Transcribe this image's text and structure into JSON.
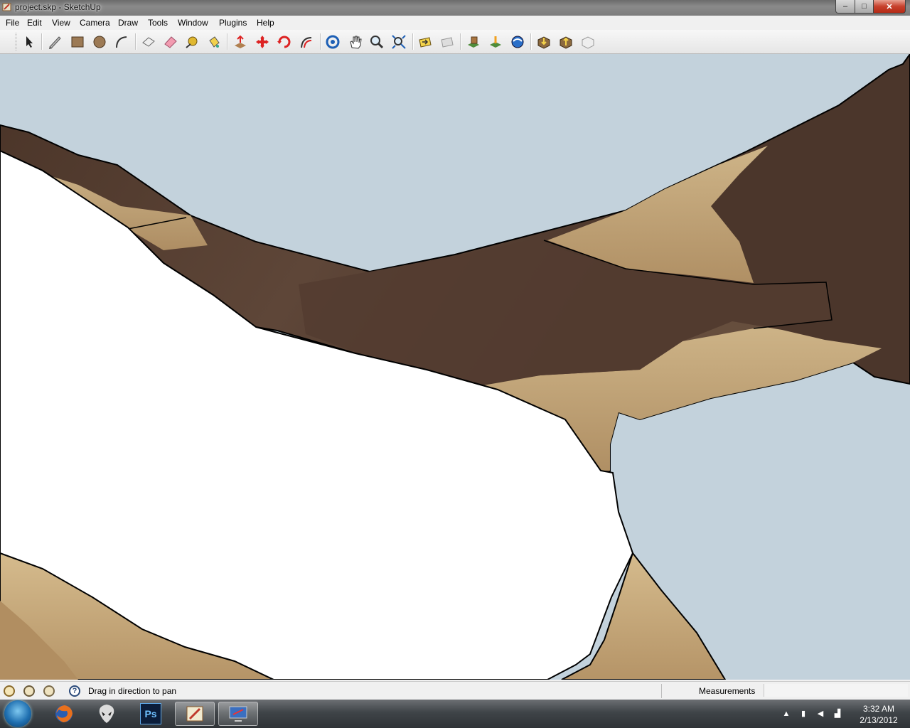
{
  "window": {
    "title": "project.skp - SketchUp",
    "controls": {
      "minimize": "–",
      "maximize": "□",
      "close": "✕"
    }
  },
  "menu": [
    "File",
    "Edit",
    "View",
    "Camera",
    "Draw",
    "Tools",
    "Window",
    "Plugins",
    "Help"
  ],
  "toolbar": {
    "tools": [
      "select-tool",
      "line-tool",
      "rectangle-tool",
      "circle-tool",
      "arc-tool",
      "make-component-tool",
      "eraser-tool",
      "tape-measure-tool",
      "paint-bucket-tool",
      "push-pull-tool",
      "move-tool",
      "rotate-tool",
      "offset-tool",
      "orbit-tool",
      "pan-tool",
      "zoom-tool",
      "zoom-extents-tool",
      "previous-view-tool",
      "next-view-tool",
      "add-location-tool",
      "toggle-terrain-tool",
      "preview-in-google-earth-tool",
      "get-models-tool",
      "share-model-tool",
      "share-component-tool"
    ]
  },
  "status": {
    "message": "Drag in direction to pan",
    "measurements_label": "Measurements",
    "measurements_value": ""
  },
  "taskbar": {
    "apps": [
      "firefox",
      "alienware",
      "photoshop",
      "sketchup",
      "remote-desktop"
    ],
    "photoshop_label": "Ps",
    "active_app": "sketchup",
    "time": "3:32 AM",
    "date": "2/13/2012"
  },
  "colors": {
    "sky": "#c3d2dc",
    "model_white": "#ffffff",
    "rock_dark": "#5a4438",
    "rock_light": "#c9ad82"
  }
}
